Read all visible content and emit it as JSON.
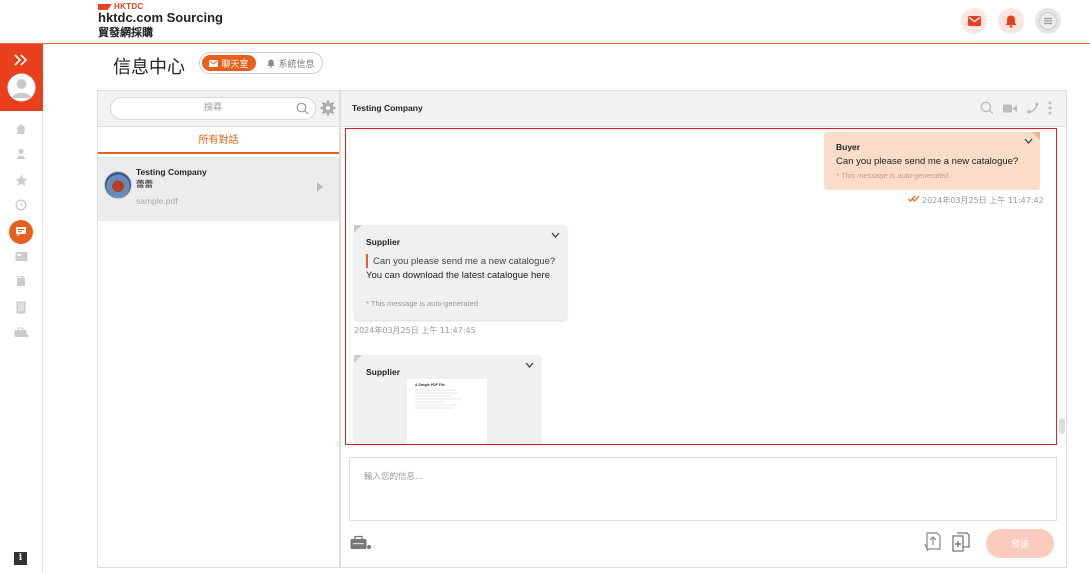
{
  "header": {
    "logo_top": "HKTDC",
    "logo_main": "hktdc.com Sourcing",
    "logo_sub": "貿發網採購"
  },
  "page": {
    "title": "信息中心",
    "tab_chat": "聊天室",
    "tab_system": "系統信息"
  },
  "conversations": {
    "search_placeholder": "搜尋",
    "filter_label": "所有對話",
    "items": [
      {
        "name": "Testing Company",
        "subtitle": "蕾蕾",
        "last_file": "sample.pdf"
      }
    ]
  },
  "chat": {
    "company": "Testing Company",
    "messages": [
      {
        "sender": "Buyer",
        "text": "Can you please send me a new catalogue?",
        "note": "* This message is auto-generated",
        "time": "2024年03月25日 上午 11:47:42"
      },
      {
        "sender": "Supplier",
        "quote": "Can you please send me a new catalogue?",
        "text": "You can download the latest catalogue here",
        "note": "* This message is auto-generated",
        "time": "2024年03月25日 上午 11:47:45"
      },
      {
        "sender": "Supplier",
        "pdf_title": "A Simple PDF File"
      }
    ],
    "input_placeholder": "輸入您的信息...",
    "send_label": "發送"
  },
  "colors": {
    "brand": "#e8401c",
    "accent": "#e8601c",
    "buyer_bubble": "#fbdcc8",
    "supplier_bubble": "#f0f0f0",
    "highlight_box": "#e02020"
  },
  "icons": [
    "mail-icon",
    "bell-icon",
    "menu-icon",
    "chevron-double-right-icon",
    "user-avatar-icon",
    "home-icon",
    "person-icon",
    "star-icon",
    "history-icon",
    "chat-icon",
    "inbox-icon",
    "bag-icon",
    "document-icon",
    "briefcase-icon",
    "info-icon",
    "search-icon",
    "gear-icon",
    "video-icon",
    "phone-icon",
    "more-icon",
    "attach-briefcase-icon",
    "add-file-icon",
    "upload-doc-icon"
  ]
}
